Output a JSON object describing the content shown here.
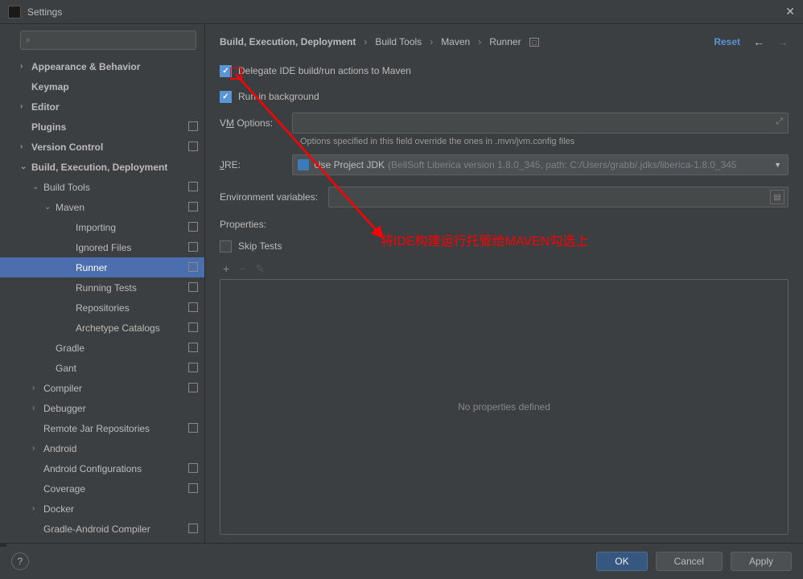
{
  "window": {
    "title": "Settings"
  },
  "search": {
    "placeholder": ""
  },
  "sidebar": [
    {
      "label": "Appearance & Behavior",
      "depth": 0,
      "chev": ">",
      "bold": true
    },
    {
      "label": "Keymap",
      "depth": 0,
      "chev": "",
      "bold": true
    },
    {
      "label": "Editor",
      "depth": 0,
      "chev": ">",
      "bold": true
    },
    {
      "label": "Plugins",
      "depth": 0,
      "chev": "",
      "bold": true,
      "badge": ""
    },
    {
      "label": "Version Control",
      "depth": 0,
      "chev": ">",
      "bold": true,
      "badge": "◻"
    },
    {
      "label": "Build, Execution, Deployment",
      "depth": 0,
      "chev": "v",
      "bold": true
    },
    {
      "label": "Build Tools",
      "depth": 1,
      "chev": "v",
      "badge": "◻"
    },
    {
      "label": "Maven",
      "depth": 2,
      "chev": "v",
      "badge": "◻"
    },
    {
      "label": "Importing",
      "depth": 3,
      "badge": "◻"
    },
    {
      "label": "Ignored Files",
      "depth": 3,
      "badge": "◻"
    },
    {
      "label": "Runner",
      "depth": 3,
      "badge": "◻",
      "selected": true
    },
    {
      "label": "Running Tests",
      "depth": 3,
      "badge": "◻"
    },
    {
      "label": "Repositories",
      "depth": 3,
      "badge": "◻"
    },
    {
      "label": "Archetype Catalogs",
      "depth": 3,
      "badge": "◻"
    },
    {
      "label": "Gradle",
      "depth": 2,
      "badge": "◻"
    },
    {
      "label": "Gant",
      "depth": 2,
      "badge": "◻"
    },
    {
      "label": "Compiler",
      "depth": 1,
      "chev": ">",
      "badge": "◻"
    },
    {
      "label": "Debugger",
      "depth": 1,
      "chev": ">"
    },
    {
      "label": "Remote Jar Repositories",
      "depth": 1,
      "badge": "◻"
    },
    {
      "label": "Android",
      "depth": 1,
      "chev": ">"
    },
    {
      "label": "Android Configurations",
      "depth": 1,
      "badge": "◻"
    },
    {
      "label": "Coverage",
      "depth": 1,
      "badge": "◻"
    },
    {
      "label": "Docker",
      "depth": 1,
      "chev": ">"
    },
    {
      "label": "Gradle-Android Compiler",
      "depth": 1,
      "badge": "◻"
    }
  ],
  "breadcrumb": {
    "root": "Build, Execution, Deployment",
    "l1": "Build Tools",
    "l2": "Maven",
    "l3": "Runner",
    "reset": "Reset"
  },
  "form": {
    "delegate_label": "Delegate IDE build/run actions to Maven",
    "delegate_checked": true,
    "background_label": "Run in background",
    "background_checked": true,
    "vm_label_pre": "V",
    "vm_label_u": "M",
    "vm_label_post": " Options:",
    "vm_hint": "Options specified in this field override the ones in .mvn/jvm.config files",
    "jre_label_u": "J",
    "jre_label_post": "RE:",
    "jre_value": "Use Project JDK",
    "jre_hint": "(BellSoft Liberica version 1.8.0_345, path: C:/Users/grabb/.jdks/liberica-1.8.0_345",
    "env_label": "Environment variables:",
    "props_label": "Properties:",
    "skip_label": "Skip Tests",
    "skip_checked": false,
    "props_empty": "No properties defined"
  },
  "footer": {
    "ok": "OK",
    "cancel": "Cancel",
    "apply": "Apply"
  },
  "annotation": "将IDE构建运行托管给MAVEN勾选上"
}
